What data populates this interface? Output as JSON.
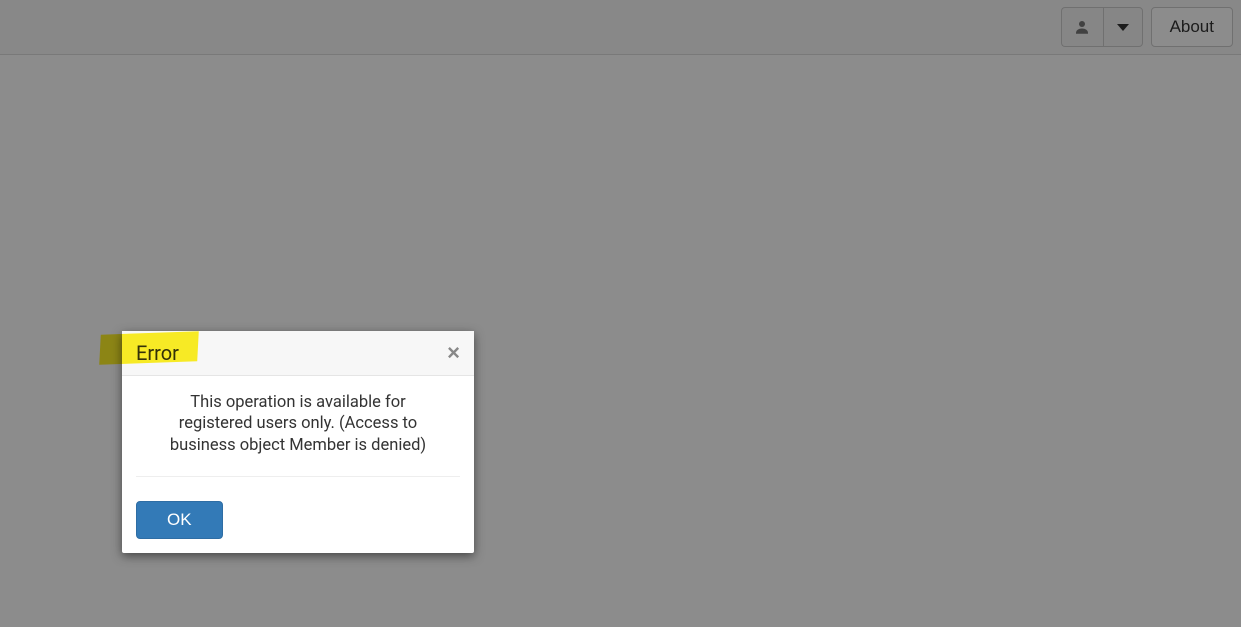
{
  "header": {
    "about_label": "About"
  },
  "modal": {
    "title": "Error",
    "message": "This operation is available for registered users only. (Access to business object Member is denied)",
    "ok_label": "OK"
  }
}
